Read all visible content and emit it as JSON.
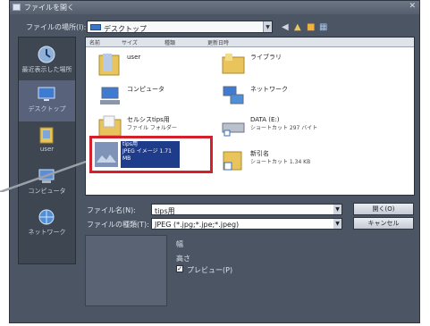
{
  "title": "ファイルを開く",
  "look_in_label": "ファイルの場所(I):",
  "look_in_value": "デスクトップ",
  "places": [
    {
      "label": "最近表示した場所"
    },
    {
      "label": "デスクトップ"
    },
    {
      "label": "user"
    },
    {
      "label": "コンピュータ"
    },
    {
      "label": "ネットワーク"
    }
  ],
  "columns": [
    "名前",
    "サイズ",
    "種類",
    "更新日時"
  ],
  "files": [
    {
      "name": "user",
      "sub": ""
    },
    {
      "name": "ライブラリ",
      "sub": ""
    },
    {
      "name": "コンピュータ",
      "sub": ""
    },
    {
      "name": "ネットワーク",
      "sub": ""
    },
    {
      "name": "セルシスtips用",
      "sub": "ファイル フォルダー"
    },
    {
      "name": "DATA (E:)",
      "sub": "ショートカット 297 バイト"
    },
    {
      "name": "tips用",
      "sub": "JPEG イメージ 1.71 MB"
    },
    {
      "name": "新引名",
      "sub": "ショートカット 1.34 KB"
    }
  ],
  "filename_label": "ファイル名(N):",
  "filename_value": "tips用",
  "filetype_label": "ファイルの種類(T):",
  "filetype_value": "JPEG (*.jpg;*.jpe;*.jpeg)",
  "open_button": "開く(O)",
  "cancel_button": "キャンセル",
  "width_label": "幅",
  "height_label": "高さ",
  "preview_label": "プレビュー(P)",
  "accent_color": "#d4202a"
}
